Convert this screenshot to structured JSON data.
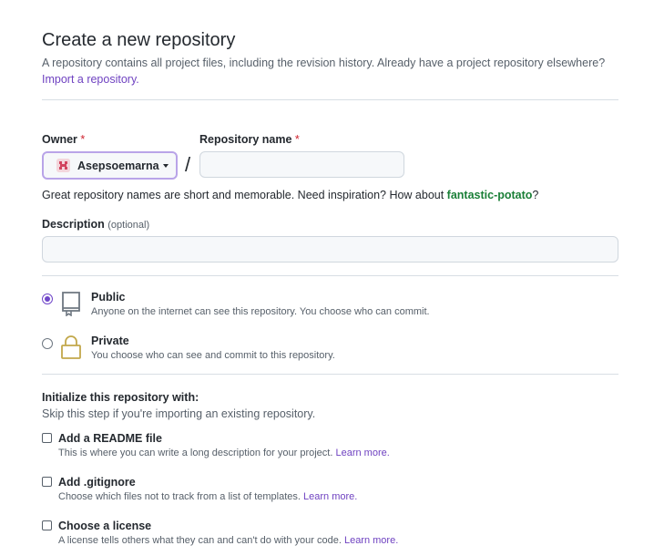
{
  "header": {
    "title": "Create a new repository",
    "subtitle": "A repository contains all project files, including the revision history. Already have a project repository elsewhere?",
    "import_link": "Import a repository."
  },
  "owner": {
    "label": "Owner",
    "required_mark": "*",
    "value": "Asepsoemarna"
  },
  "separator": "/",
  "repo_name": {
    "label": "Repository name",
    "required_mark": "*",
    "value": ""
  },
  "hint": {
    "text": "Great repository names are short and memorable. Need inspiration? How about ",
    "suggestion": "fantastic-potato",
    "end": "?"
  },
  "description": {
    "label": "Description",
    "optional": "(optional)",
    "value": ""
  },
  "visibility": {
    "public": {
      "title": "Public",
      "desc": "Anyone on the internet can see this repository. You choose who can commit.",
      "selected": true
    },
    "private": {
      "title": "Private",
      "desc": "You choose who can see and commit to this repository.",
      "selected": false
    }
  },
  "init": {
    "title": "Initialize this repository with:",
    "subtitle": "Skip this step if you're importing an existing repository.",
    "readme": {
      "title": "Add a README file",
      "desc": "This is where you can write a long description for your project.",
      "link": "Learn more."
    },
    "gitignore": {
      "title": "Add .gitignore",
      "desc": "Choose which files not to track from a list of templates.",
      "link": "Learn more."
    },
    "license": {
      "title": "Choose a license",
      "desc": "A license tells others what they can and can't do with your code.",
      "link": "Learn more."
    }
  },
  "colors": {
    "accent": "#7047c9",
    "link": "#6f42c1",
    "suggestion": "#1a7f37",
    "required": "#cf222e"
  }
}
